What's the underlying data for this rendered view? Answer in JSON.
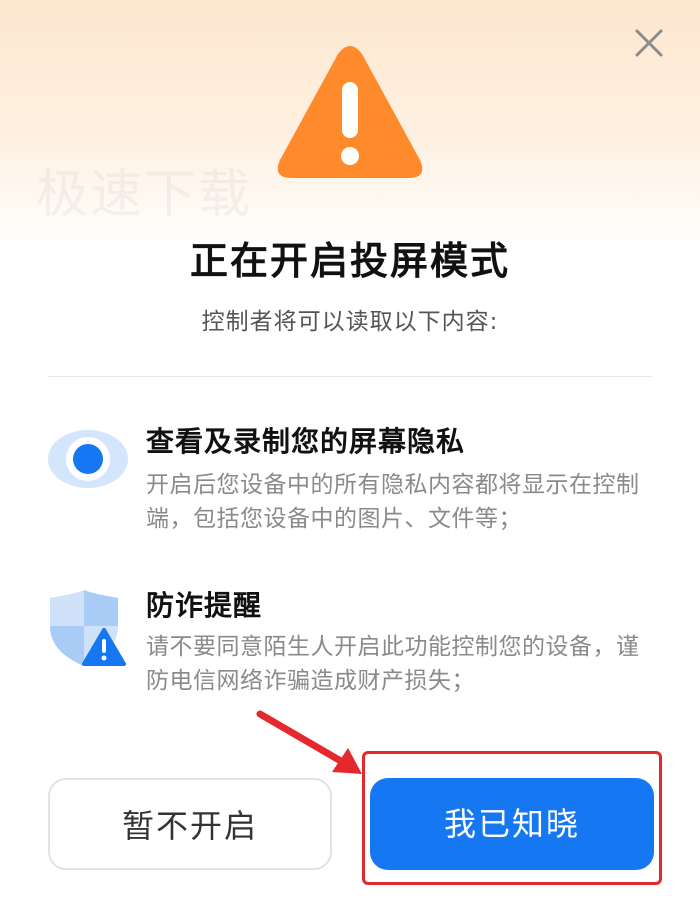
{
  "watermark": "极速下载",
  "dialog": {
    "title": "正在开启投屏模式",
    "subtitle": "控制者将可以读取以下内容:",
    "permissions": [
      {
        "icon": "eye-icon",
        "title": "查看及录制您的屏幕隐私",
        "description": "开启后您设备中的所有隐私内容都将显示在控制端，包括您设备中的图片、文件等；"
      },
      {
        "icon": "shield-warning-icon",
        "title": "防诈提醒",
        "description": "请不要同意陌生人开启此功能控制您的设备，谨防电信网络诈骗造成财产损失；"
      }
    ],
    "buttons": {
      "cancel": "暂不开启",
      "confirm": "我已知晓"
    }
  },
  "colors": {
    "accent": "#1677f3",
    "warning": "#ff8a2b",
    "annotation": "#e5282e",
    "header_gradient": "#fde7cf"
  }
}
